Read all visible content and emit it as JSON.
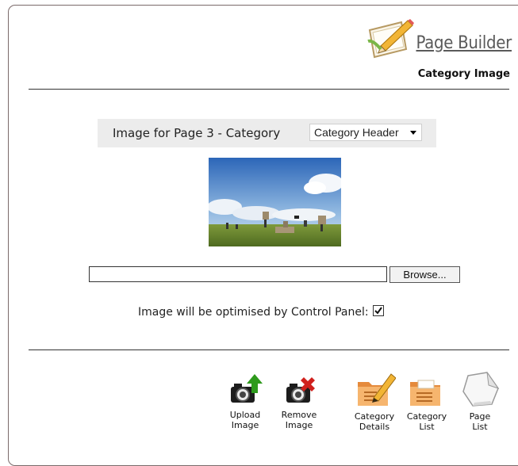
{
  "header": {
    "logo_text": "Page Builder",
    "subtitle": "Category Image"
  },
  "image_section": {
    "label": "Image for Page 3 - Category",
    "select_value": "Category Header"
  },
  "upload": {
    "file_value": "",
    "browse_label": "Browse..."
  },
  "optimise": {
    "label": "Image will be optimised by Control Panel:",
    "checked": true
  },
  "toolbar": {
    "upload_image": {
      "line1": "Upload",
      "line2": "Image"
    },
    "remove_image": {
      "line1": "Remove",
      "line2": "Image"
    },
    "category_details": {
      "line1": "Category",
      "line2": "Details"
    },
    "category_list": {
      "line1": "Category",
      "line2": "List"
    },
    "page_list": {
      "line1": "Page",
      "line2": "List"
    }
  },
  "colors": {
    "accent_green": "#2e9a1c",
    "accent_red": "#d0201c",
    "folder_orange": "#f0a35a"
  },
  "icons": [
    "page-builder-logo-icon",
    "camera-upload-icon",
    "camera-remove-icon",
    "folder-pencil-icon",
    "folder-list-icon",
    "page-list-icon"
  ]
}
